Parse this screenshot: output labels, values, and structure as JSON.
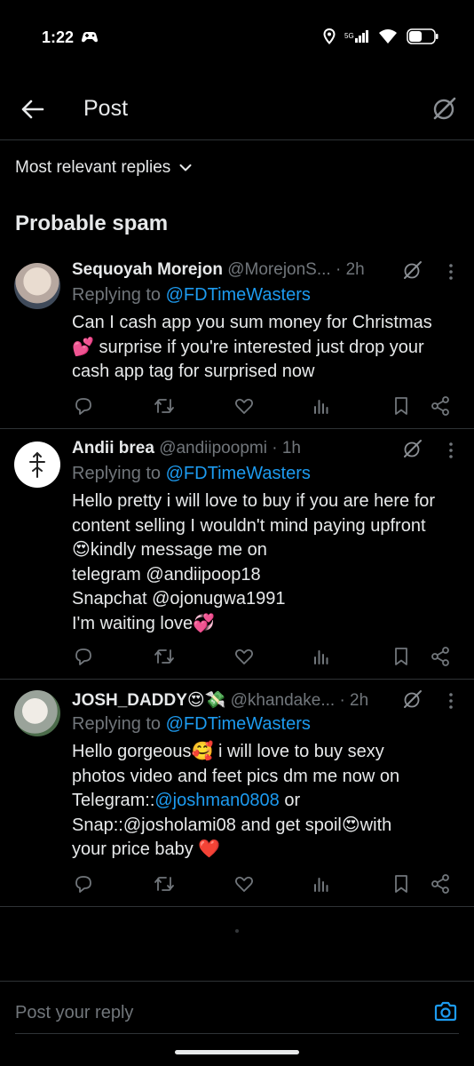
{
  "status_bar": {
    "time": "1:22"
  },
  "header": {
    "title": "Post"
  },
  "sort": {
    "label": "Most relevant replies"
  },
  "section": {
    "title": "Probable spam"
  },
  "replies": [
    {
      "name": "Sequoyah Morejon",
      "handle": "@MorejonS...",
      "time": "· 2h",
      "replying_prefix": "Replying to ",
      "replying_to": "@FDTimeWasters",
      "lines": [
        "Can I cash app you sum money for Christmas",
        "💕 surprise if you're interested just drop your",
        "cash app tag for surprised now"
      ]
    },
    {
      "name": "Andii brea",
      "handle": "@andiipoopmi",
      "time": "· 1h",
      "replying_prefix": "Replying to ",
      "replying_to": "@FDTimeWasters",
      "lines": [
        "Hello pretty i will love to buy if you are here for",
        "content selling I wouldn't mind paying upfront",
        "😍kindly message me on",
        "telegram @andiipoop18",
        "Snapchat @ojonugwa1991",
        "I'm waiting love💞"
      ]
    },
    {
      "name": "JOSH_DADDY😍💸",
      "handle": "@khandake...",
      "time": "· 2h",
      "replying_prefix": "Replying to ",
      "replying_to": "@FDTimeWasters",
      "line1": "Hello gorgeous🥰 i will love to buy sexy",
      "line2": "photos video and feet pics dm me now on",
      "line3_prefix": "Telegram::",
      "line3_link": "@joshman0808",
      "line3_suffix": " or",
      "line4": "Snap::@josholami08 and get spoil😍with",
      "line5": "your price baby ❤️"
    }
  ],
  "compose": {
    "placeholder": "Post your reply"
  },
  "colors": {
    "background": "#000000",
    "text": "#e7e9ea",
    "muted": "#71767b",
    "link": "#1d9bf0",
    "divider": "#2f3336"
  }
}
